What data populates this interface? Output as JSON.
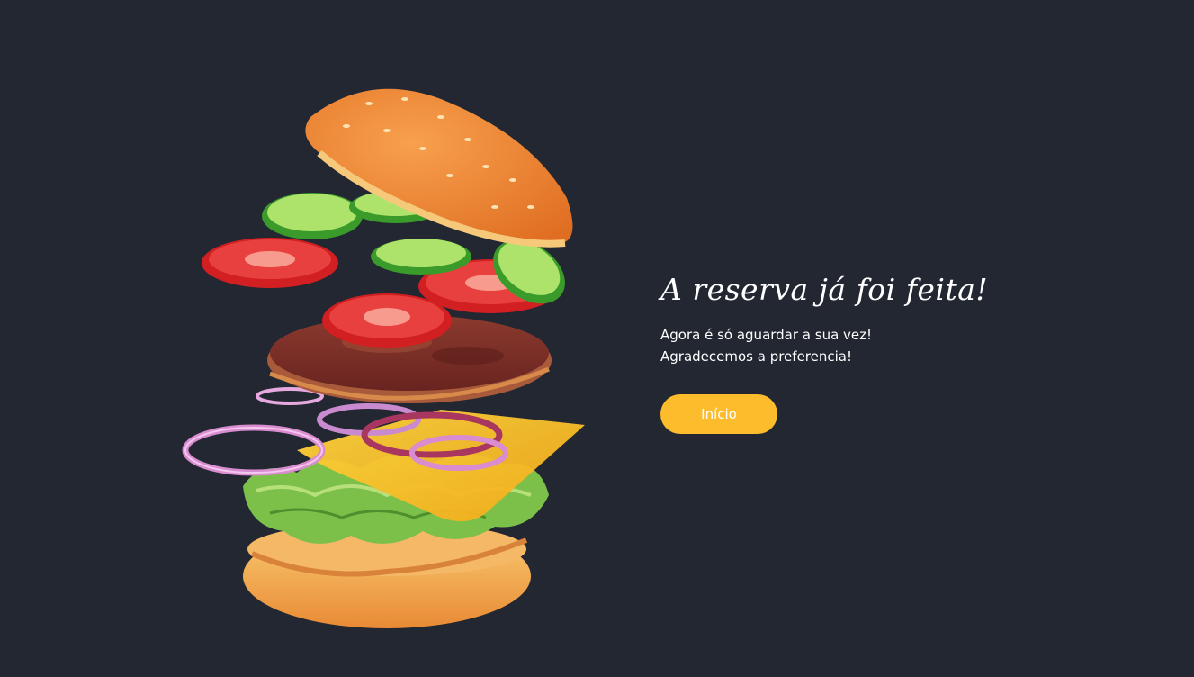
{
  "page": {
    "background_color": "#222732"
  },
  "reservation": {
    "title": "A reserva já foi feita!",
    "message_line_1": "Agora é só aguardar a sua vez!",
    "message_line_2": "Agradecemos a preferencia!",
    "home_button_label": "Início",
    "button_color": "#fdbc2c"
  },
  "illustration": {
    "icon": "exploded-burger-illustration"
  }
}
